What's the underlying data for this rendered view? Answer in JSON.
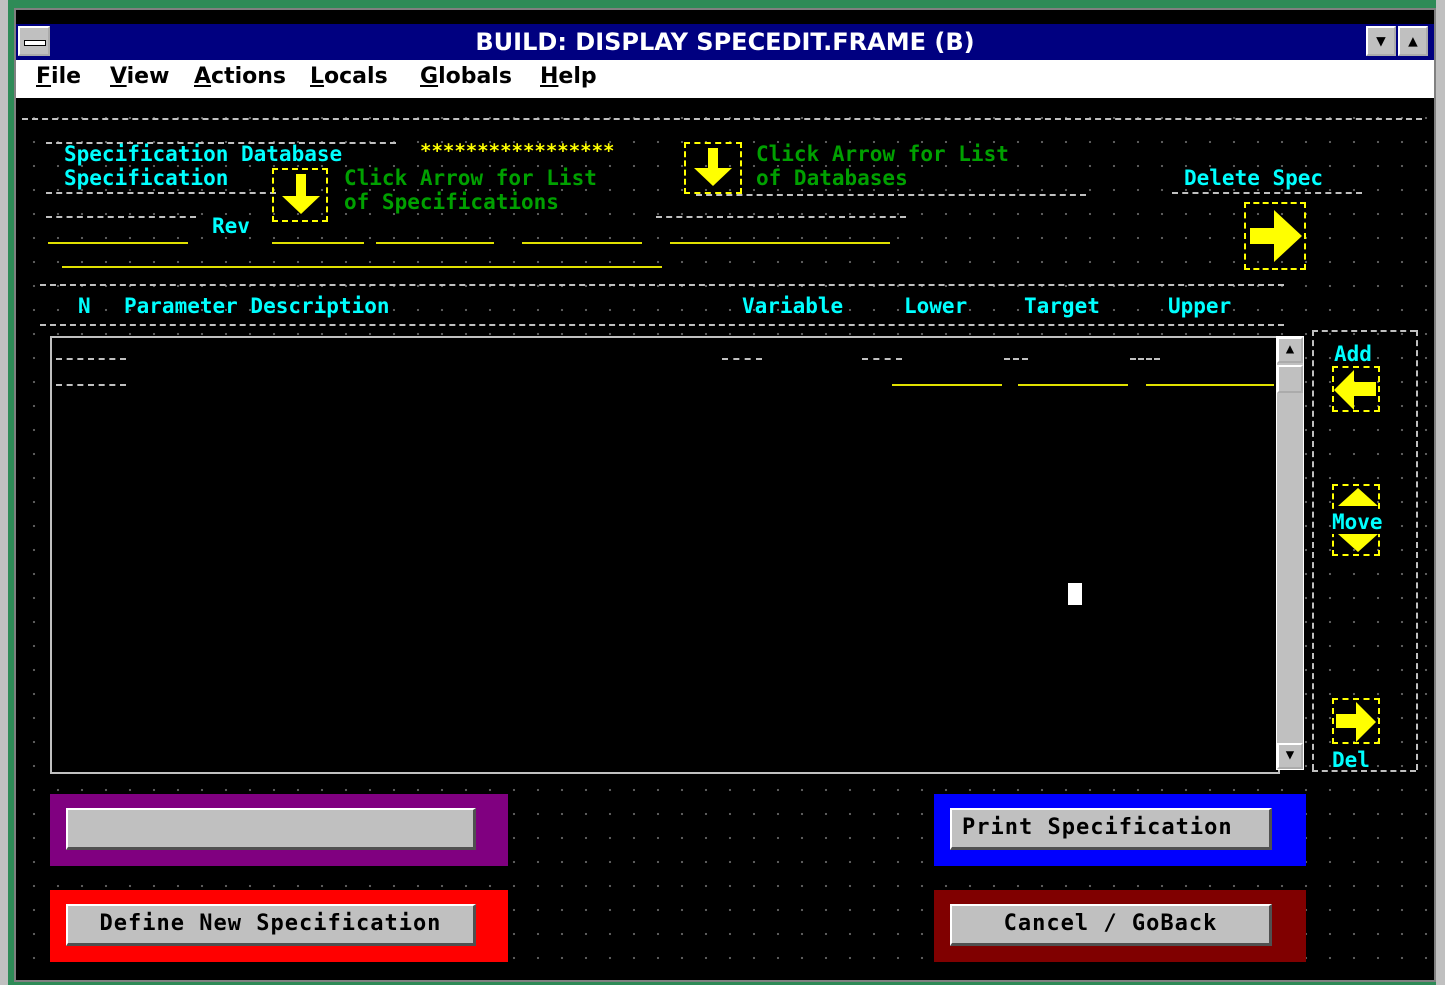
{
  "window": {
    "title": "BUILD: DISPLAY SPECEDIT.FRAME (B)"
  },
  "titlebar": {
    "minimize_glyph": "▼",
    "maximize_glyph": "▲"
  },
  "menu": [
    "File",
    "View",
    "Actions",
    "Locals",
    "Globals",
    "Help"
  ],
  "form": {
    "spec_db_label": "Specification Database",
    "spec_db_value": "*****************",
    "click_arrow_list_1": "Click Arrow for List",
    "of_databases": "of Databases",
    "spec_label": "Specification",
    "click_arrow_list_2": "Click Arrow for List",
    "of_specifications": "of Specifications",
    "rev_label": "Rev",
    "delete_spec_label": "Delete Spec"
  },
  "table": {
    "columns": [
      "N",
      "Parameter Description",
      "Variable",
      "Lower",
      "Target",
      "Upper"
    ]
  },
  "side": {
    "add": "Add",
    "move": "Move",
    "del": "Del"
  },
  "buttons": {
    "blank": "",
    "print": "Print Specification",
    "define_new": "Define New Specification",
    "cancel": "Cancel / GoBack"
  },
  "colors": {
    "purple_panel": "#800080",
    "blue_panel": "#0000ff",
    "red_panel": "#ff0000",
    "darkred_panel": "#800000"
  }
}
